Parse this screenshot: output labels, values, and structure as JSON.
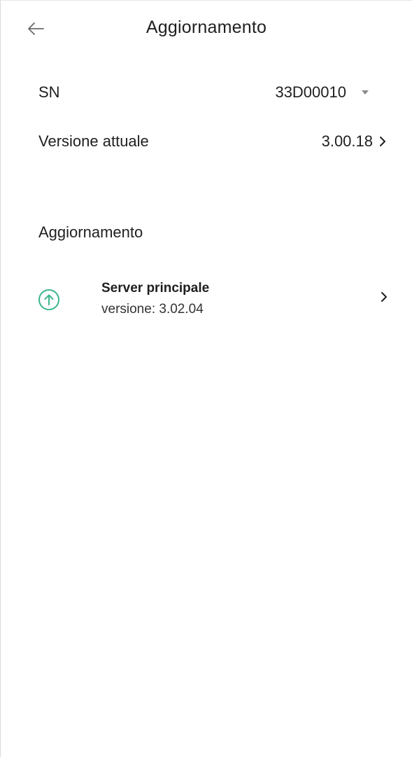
{
  "header": {
    "title": "Aggiornamento",
    "back_icon": "arrow-left-icon"
  },
  "device": {
    "sn_label": "SN",
    "sn_value": "33D00010",
    "sn_dropdown_icon": "caret-down-icon",
    "version_label": "Versione attuale",
    "version_value": "3.00.18",
    "version_chevron_icon": "chevron-right-icon"
  },
  "updates": {
    "section_title": "Aggiornamento",
    "items": [
      {
        "icon": "upgrade-arrow-icon",
        "title": "Server principale",
        "subtitle": "versione:  3.02.04",
        "chevron_icon": "chevron-right-icon"
      }
    ]
  },
  "colors": {
    "accent": "#3bb58a",
    "text": "#1f1f1f",
    "muted": "#8a8a8a"
  }
}
